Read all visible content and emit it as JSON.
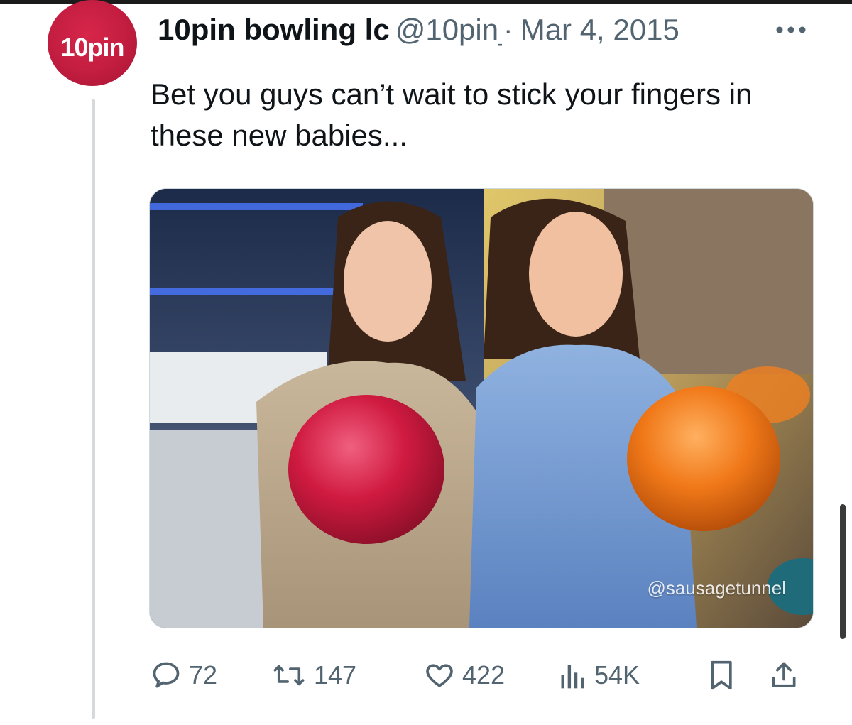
{
  "tweet": {
    "avatar_text": "10pin",
    "display_name": "10pin bowling lc",
    "handle": "@10pin_",
    "date": "Mar 4, 2015",
    "text": "Bet you guys can’t wait to stick your fingers in these new babies...",
    "media": {
      "watermark": "@sausagetunnel"
    },
    "actions": {
      "replies": "72",
      "reposts": "147",
      "likes": "422",
      "views": "54K"
    }
  },
  "colors": {
    "avatar": "#c21d40",
    "text": "#0f1419",
    "secondary": "#536471"
  },
  "icons": [
    "more-icon",
    "reply-icon",
    "repost-icon",
    "like-icon",
    "views-icon",
    "bookmark-icon",
    "share-icon"
  ]
}
